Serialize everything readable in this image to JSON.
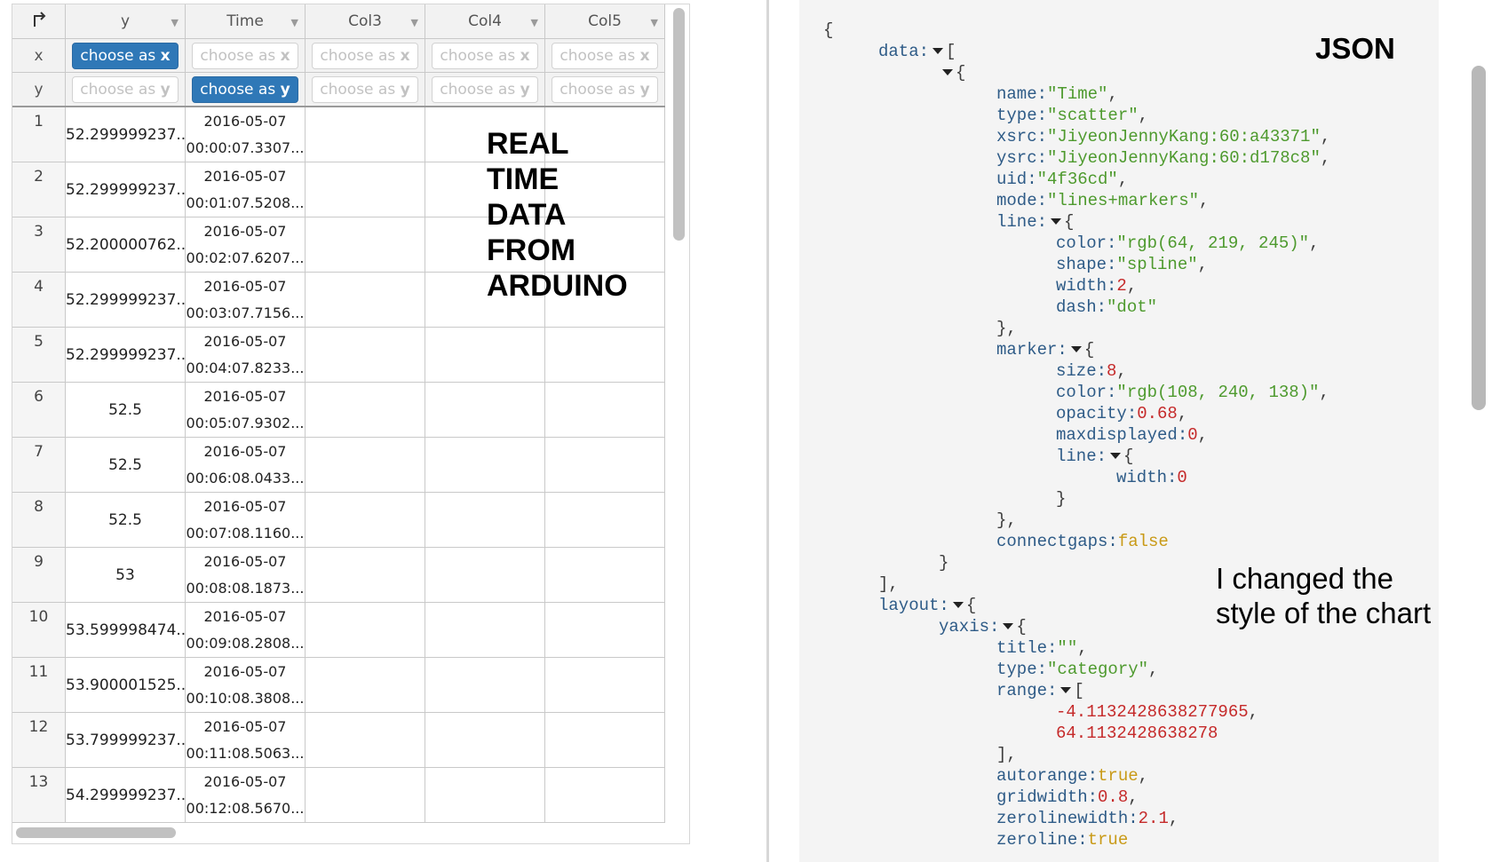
{
  "grid": {
    "corner_icon": "transpose-arrow-icon",
    "columns": [
      {
        "label": "y",
        "x_button": "choose as",
        "x_suffix": "x",
        "x_active": true,
        "y_button": "choose as",
        "y_suffix": "y",
        "y_active": false
      },
      {
        "label": "Time",
        "x_button": "choose as",
        "x_suffix": "x",
        "x_active": false,
        "y_button": "choose as",
        "y_suffix": "y",
        "y_active": true
      },
      {
        "label": "Col3",
        "x_button": "choose as",
        "x_suffix": "x",
        "x_active": false,
        "y_button": "choose as",
        "y_suffix": "y",
        "y_active": false
      },
      {
        "label": "Col4",
        "x_button": "choose as",
        "x_suffix": "x",
        "x_active": false,
        "y_button": "choose as",
        "y_suffix": "y",
        "y_active": false
      },
      {
        "label": "Col5",
        "x_button": "choose as",
        "x_suffix": "x",
        "x_active": false,
        "y_button": "choose as",
        "y_suffix": "y",
        "y_active": false
      }
    ],
    "role_labels": {
      "x": "x",
      "y": "y"
    },
    "rows": [
      {
        "num": "1",
        "y": "52.299999237...",
        "date": "2016-05-07",
        "time": "00:00:07.3307..."
      },
      {
        "num": "2",
        "y": "52.299999237...",
        "date": "2016-05-07",
        "time": "00:01:07.5208..."
      },
      {
        "num": "3",
        "y": "52.200000762...",
        "date": "2016-05-07",
        "time": "00:02:07.6207..."
      },
      {
        "num": "4",
        "y": "52.299999237...",
        "date": "2016-05-07",
        "time": "00:03:07.7156..."
      },
      {
        "num": "5",
        "y": "52.299999237...",
        "date": "2016-05-07",
        "time": "00:04:07.8233..."
      },
      {
        "num": "6",
        "y": "52.5",
        "date": "2016-05-07",
        "time": "00:05:07.9302..."
      },
      {
        "num": "7",
        "y": "52.5",
        "date": "2016-05-07",
        "time": "00:06:08.0433..."
      },
      {
        "num": "8",
        "y": "52.5",
        "date": "2016-05-07",
        "time": "00:07:08.1160..."
      },
      {
        "num": "9",
        "y": "53",
        "date": "2016-05-07",
        "time": "00:08:08.1873..."
      },
      {
        "num": "10",
        "y": "53.599998474...",
        "date": "2016-05-07",
        "time": "00:09:08.2808..."
      },
      {
        "num": "11",
        "y": "53.900001525...",
        "date": "2016-05-07",
        "time": "00:10:08.3808..."
      },
      {
        "num": "12",
        "y": "53.799999237...",
        "date": "2016-05-07",
        "time": "00:11:08.5063..."
      },
      {
        "num": "13",
        "y": "54.299999237...",
        "date": "2016-05-07",
        "time": "00:12:08.5670..."
      }
    ],
    "overlay_text": [
      "REAL",
      "TIME",
      "DATA",
      "FROM",
      "ARDUINO"
    ]
  },
  "json_panel": {
    "title": "JSON",
    "note": "I changed the style of the chart",
    "lines": [
      {
        "indent": 0,
        "parts": [
          {
            "c": "p",
            "t": "{"
          }
        ]
      },
      {
        "indent": 1,
        "parts": [
          {
            "c": "k",
            "t": "data:"
          },
          {
            "c": "tri"
          },
          {
            "c": "p",
            "t": "["
          }
        ]
      },
      {
        "indent": 2,
        "parts": [
          {
            "c": "tri"
          },
          {
            "c": "p",
            "t": "{"
          }
        ]
      },
      {
        "indent": 3,
        "parts": [
          {
            "c": "k",
            "t": "name:"
          },
          {
            "c": "s",
            "t": "\"Time\""
          },
          {
            "c": "p",
            "t": ","
          }
        ]
      },
      {
        "indent": 3,
        "parts": [
          {
            "c": "k",
            "t": "type:"
          },
          {
            "c": "s",
            "t": "\"scatter\""
          },
          {
            "c": "p",
            "t": ","
          }
        ]
      },
      {
        "indent": 3,
        "parts": [
          {
            "c": "k",
            "t": "xsrc:"
          },
          {
            "c": "s",
            "t": "\"JiyeonJennyKang:60:a43371\""
          },
          {
            "c": "p",
            "t": ","
          }
        ]
      },
      {
        "indent": 3,
        "parts": [
          {
            "c": "k",
            "t": "ysrc:"
          },
          {
            "c": "s",
            "t": "\"JiyeonJennyKang:60:d178c8\""
          },
          {
            "c": "p",
            "t": ","
          }
        ]
      },
      {
        "indent": 3,
        "parts": [
          {
            "c": "k",
            "t": "uid:"
          },
          {
            "c": "s",
            "t": "\"4f36cd\""
          },
          {
            "c": "p",
            "t": ","
          }
        ]
      },
      {
        "indent": 3,
        "parts": [
          {
            "c": "k",
            "t": "mode:"
          },
          {
            "c": "s",
            "t": "\"lines+markers\""
          },
          {
            "c": "p",
            "t": ","
          }
        ]
      },
      {
        "indent": 3,
        "parts": [
          {
            "c": "k",
            "t": "line:"
          },
          {
            "c": "tri"
          },
          {
            "c": "p",
            "t": "{"
          }
        ]
      },
      {
        "indent": 4,
        "parts": [
          {
            "c": "k",
            "t": "color:"
          },
          {
            "c": "s",
            "t": "\"rgb(64, 219, 245)\""
          },
          {
            "c": "p",
            "t": ","
          }
        ]
      },
      {
        "indent": 4,
        "parts": [
          {
            "c": "k",
            "t": "shape:"
          },
          {
            "c": "s",
            "t": "\"spline\""
          },
          {
            "c": "p",
            "t": ","
          }
        ]
      },
      {
        "indent": 4,
        "parts": [
          {
            "c": "k",
            "t": "width:"
          },
          {
            "c": "n",
            "t": "2"
          },
          {
            "c": "p",
            "t": ","
          }
        ]
      },
      {
        "indent": 4,
        "parts": [
          {
            "c": "k",
            "t": "dash:"
          },
          {
            "c": "s",
            "t": "\"dot\""
          }
        ]
      },
      {
        "indent": 3,
        "parts": [
          {
            "c": "p",
            "t": "},"
          }
        ]
      },
      {
        "indent": 3,
        "parts": [
          {
            "c": "k",
            "t": "marker:"
          },
          {
            "c": "tri"
          },
          {
            "c": "p",
            "t": "{"
          }
        ]
      },
      {
        "indent": 4,
        "parts": [
          {
            "c": "k",
            "t": "size:"
          },
          {
            "c": "n",
            "t": "8"
          },
          {
            "c": "p",
            "t": ","
          }
        ]
      },
      {
        "indent": 4,
        "parts": [
          {
            "c": "k",
            "t": "color:"
          },
          {
            "c": "s",
            "t": "\"rgb(108, 240, 138)\""
          },
          {
            "c": "p",
            "t": ","
          }
        ]
      },
      {
        "indent": 4,
        "parts": [
          {
            "c": "k",
            "t": "opacity:"
          },
          {
            "c": "n",
            "t": "0.68"
          },
          {
            "c": "p",
            "t": ","
          }
        ]
      },
      {
        "indent": 4,
        "parts": [
          {
            "c": "k",
            "t": "maxdisplayed:"
          },
          {
            "c": "n",
            "t": "0"
          },
          {
            "c": "p",
            "t": ","
          }
        ]
      },
      {
        "indent": 4,
        "parts": [
          {
            "c": "k",
            "t": "line:"
          },
          {
            "c": "tri"
          },
          {
            "c": "p",
            "t": "{"
          }
        ]
      },
      {
        "indent": 5,
        "parts": [
          {
            "c": "k",
            "t": "width:"
          },
          {
            "c": "n",
            "t": "0"
          }
        ]
      },
      {
        "indent": 4,
        "parts": [
          {
            "c": "p",
            "t": "}"
          }
        ]
      },
      {
        "indent": 3,
        "parts": [
          {
            "c": "p",
            "t": "},"
          }
        ]
      },
      {
        "indent": 3,
        "parts": [
          {
            "c": "k",
            "t": "connectgaps:"
          },
          {
            "c": "b",
            "t": "false"
          }
        ]
      },
      {
        "indent": 2,
        "parts": [
          {
            "c": "p",
            "t": "}"
          }
        ]
      },
      {
        "indent": 1,
        "parts": [
          {
            "c": "p",
            "t": "],"
          }
        ]
      },
      {
        "indent": 1,
        "parts": [
          {
            "c": "k",
            "t": "layout:"
          },
          {
            "c": "tri"
          },
          {
            "c": "p",
            "t": "{"
          }
        ]
      },
      {
        "indent": 2,
        "parts": [
          {
            "c": "k",
            "t": "yaxis:"
          },
          {
            "c": "tri"
          },
          {
            "c": "p",
            "t": "{"
          }
        ]
      },
      {
        "indent": 3,
        "parts": [
          {
            "c": "k",
            "t": "title:"
          },
          {
            "c": "s",
            "t": "\"\""
          },
          {
            "c": "p",
            "t": ","
          }
        ]
      },
      {
        "indent": 3,
        "parts": [
          {
            "c": "k",
            "t": "type:"
          },
          {
            "c": "s",
            "t": "\"category\""
          },
          {
            "c": "p",
            "t": ","
          }
        ]
      },
      {
        "indent": 3,
        "parts": [
          {
            "c": "k",
            "t": "range:"
          },
          {
            "c": "tri"
          },
          {
            "c": "p",
            "t": "["
          }
        ]
      },
      {
        "indent": 4,
        "parts": [
          {
            "c": "n",
            "t": "-4.1132428638277965"
          },
          {
            "c": "p",
            "t": ","
          }
        ]
      },
      {
        "indent": 4,
        "parts": [
          {
            "c": "n",
            "t": "64.1132428638278"
          }
        ]
      },
      {
        "indent": 3,
        "parts": [
          {
            "c": "p",
            "t": "],"
          }
        ]
      },
      {
        "indent": 3,
        "parts": [
          {
            "c": "k",
            "t": "autorange:"
          },
          {
            "c": "b",
            "t": "true"
          },
          {
            "c": "p",
            "t": ","
          }
        ]
      },
      {
        "indent": 3,
        "parts": [
          {
            "c": "k",
            "t": "gridwidth:"
          },
          {
            "c": "n",
            "t": "0.8"
          },
          {
            "c": "p",
            "t": ","
          }
        ]
      },
      {
        "indent": 3,
        "parts": [
          {
            "c": "k",
            "t": "zerolinewidth:"
          },
          {
            "c": "n",
            "t": "2.1"
          },
          {
            "c": "p",
            "t": ","
          }
        ]
      },
      {
        "indent": 3,
        "parts": [
          {
            "c": "k",
            "t": "zeroline:"
          },
          {
            "c": "b",
            "t": "true"
          }
        ]
      }
    ]
  },
  "colors": {
    "active_button": "#2f78b7",
    "json_key": "#2e5b87",
    "json_string": "#4e9a2e",
    "json_number": "#c52a2a",
    "json_boolean": "#c99a17"
  }
}
